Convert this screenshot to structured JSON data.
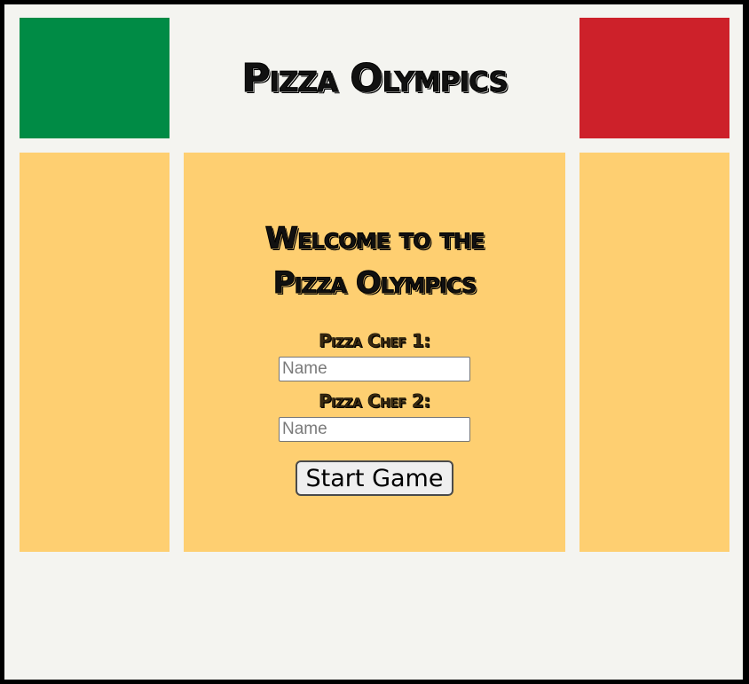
{
  "header": {
    "title": "Pizza Olympics"
  },
  "colors": {
    "flag_green": "#008b45",
    "flag_red": "#cd212a",
    "panel_yellow": "#fecf71",
    "page_background": "#f4f4f0",
    "outer_border": "#000000"
  },
  "welcome": {
    "line1": "Welcome to the",
    "line2": "Pizza Olympics"
  },
  "form": {
    "chef1_label": "Pizza Chef 1:",
    "chef1_placeholder": "Name",
    "chef1_value": "",
    "chef2_label": "Pizza Chef 2:",
    "chef2_placeholder": "Name",
    "chef2_value": "",
    "start_label": "Start Game"
  }
}
